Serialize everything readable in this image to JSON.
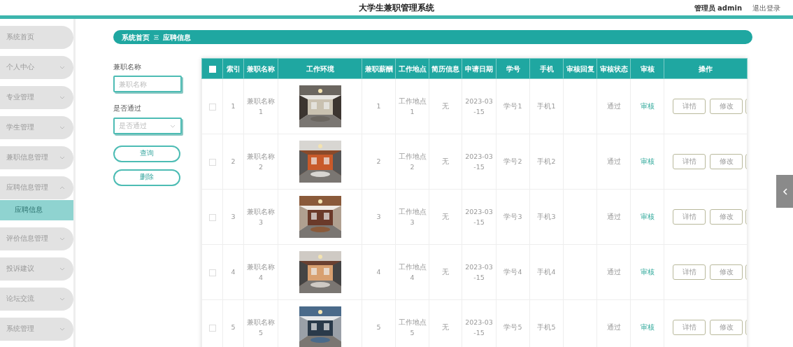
{
  "header": {
    "title": "大学生兼职管理系统",
    "user": "管理员 admin",
    "logout": "退出登录"
  },
  "sidebar": {
    "items": [
      {
        "label": "系统首页"
      },
      {
        "label": "个人中心",
        "expanded": false
      },
      {
        "label": "专业管理",
        "expanded": false
      },
      {
        "label": "学生管理",
        "expanded": false
      },
      {
        "label": "兼职信息管理",
        "expanded": false
      },
      {
        "label": "应聘信息管理",
        "expanded": true,
        "children": [
          {
            "label": "应聘信息",
            "selected": true
          }
        ]
      },
      {
        "label": "评价信息管理",
        "expanded": false
      },
      {
        "label": "投诉建议",
        "expanded": false
      },
      {
        "label": "论坛交流",
        "expanded": false
      },
      {
        "label": "系统管理",
        "expanded": false
      }
    ]
  },
  "breadcrumb": [
    "系统首页",
    "应聘信息"
  ],
  "search": {
    "fields": [
      {
        "kind": "text",
        "label": "兼职名称",
        "placeholder": "兼职名称"
      },
      {
        "kind": "select",
        "label": "是否通过",
        "placeholder": "是否通过"
      }
    ],
    "buttons": [
      "查询",
      "删除"
    ]
  },
  "table": {
    "select_all": false,
    "columns": [
      "索引",
      "兼职名称",
      "工作环境",
      "兼职薪酬",
      "工作地点",
      "简历信息",
      "申请日期",
      "学号",
      "手机",
      "审核回复",
      "审核状态",
      "审核",
      "操作"
    ],
    "rows": [
      {
        "selected": false,
        "index": "1",
        "name": "兼职名称1",
        "pay": "1",
        "place": "工作地点1",
        "resume": "无",
        "date": "2023-03-15",
        "student_no": "学号1",
        "phone": "手机1",
        "status": "通过",
        "review": "审核",
        "actions": [
          "详情",
          "修改"
        ]
      },
      {
        "selected": false,
        "index": "2",
        "name": "兼职名称2",
        "pay": "2",
        "place": "工作地点2",
        "resume": "无",
        "date": "2023-03-15",
        "student_no": "学号2",
        "phone": "手机2",
        "status": "通过",
        "review": "审核",
        "actions": [
          "详情",
          "修改"
        ]
      },
      {
        "selected": false,
        "index": "3",
        "name": "兼职名称3",
        "pay": "3",
        "place": "工作地点3",
        "resume": "无",
        "date": "2023-03-15",
        "student_no": "学号3",
        "phone": "手机3",
        "status": "通过",
        "review": "审核",
        "actions": [
          "详情",
          "修改"
        ]
      },
      {
        "selected": false,
        "index": "4",
        "name": "兼职名称4",
        "pay": "4",
        "place": "工作地点4",
        "resume": "无",
        "date": "2023-03-15",
        "student_no": "学号4",
        "phone": "手机4",
        "status": "通过",
        "review": "审核",
        "actions": [
          "详情",
          "修改"
        ]
      },
      {
        "selected": false,
        "index": "5",
        "name": "兼职名称5",
        "pay": "5",
        "place": "工作地点5",
        "resume": "无",
        "date": "2023-03-15",
        "student_no": "学号5",
        "phone": "手机5",
        "status": "通过",
        "review": "审核",
        "actions": [
          "详情",
          "修改"
        ]
      }
    ]
  }
}
